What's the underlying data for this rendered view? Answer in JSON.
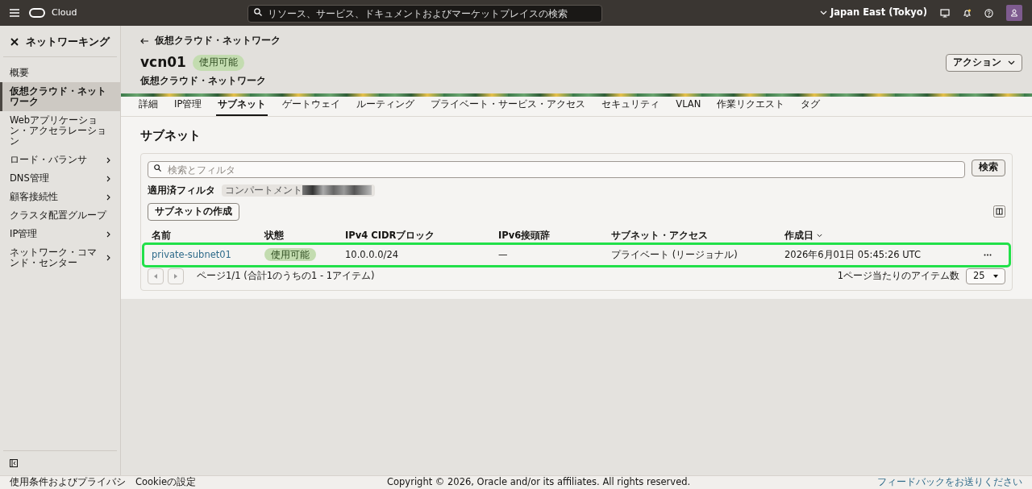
{
  "topbar": {
    "brand": "Cloud",
    "search_placeholder": "リソース、サービス、ドキュメントおよびマーケットプレイスの検索",
    "region": "Japan East (Tokyo)"
  },
  "sidebar": {
    "title": "ネットワーキング",
    "items": [
      {
        "label": "概要",
        "selected": false,
        "expandable": false
      },
      {
        "label": "仮想クラウド・ネットワーク",
        "selected": true,
        "expandable": false
      },
      {
        "label": "Webアプリケーション・アクセラレーション",
        "selected": false,
        "expandable": false
      },
      {
        "label": "ロード・バランサ",
        "selected": false,
        "expandable": true
      },
      {
        "label": "DNS管理",
        "selected": false,
        "expandable": true
      },
      {
        "label": "顧客接続性",
        "selected": false,
        "expandable": true
      },
      {
        "label": "クラスタ配置グループ",
        "selected": false,
        "expandable": false
      },
      {
        "label": "IP管理",
        "selected": false,
        "expandable": true
      },
      {
        "label": "ネットワーク・コマンド・センター",
        "selected": false,
        "expandable": true
      }
    ]
  },
  "header": {
    "breadcrumb": "仮想クラウド・ネットワーク",
    "name": "vcn01",
    "status": "使用可能",
    "type": "仮想クラウド・ネットワーク",
    "actions_button": "アクション"
  },
  "tabs": [
    {
      "label": "詳細",
      "selected": false
    },
    {
      "label": "IP管理",
      "selected": false
    },
    {
      "label": "サブネット",
      "selected": true
    },
    {
      "label": "ゲートウェイ",
      "selected": false
    },
    {
      "label": "ルーティング",
      "selected": false
    },
    {
      "label": "プライベート・サービス・アクセス",
      "selected": false
    },
    {
      "label": "セキュリティ",
      "selected": false
    },
    {
      "label": "VLAN",
      "selected": false
    },
    {
      "label": "作業リクエスト",
      "selected": false
    },
    {
      "label": "タグ",
      "selected": false
    }
  ],
  "section": {
    "title": "サブネット",
    "search_placeholder": "検索とフィルタ",
    "search_button": "検索",
    "applied_filter_label": "適用済フィルタ",
    "filter_chip": "コンパートメント",
    "create_button": "サブネットの作成"
  },
  "table": {
    "columns": [
      {
        "label": "名前",
        "sorted": false
      },
      {
        "label": "状態",
        "sorted": false
      },
      {
        "label": "IPv4 CIDRブロック",
        "sorted": false
      },
      {
        "label": "IPv6接頭辞",
        "sorted": false
      },
      {
        "label": "サブネット・アクセス",
        "sorted": false
      },
      {
        "label": "作成日",
        "sorted": true
      }
    ],
    "rows": [
      {
        "name": "private-subnet01",
        "status": "使用可能",
        "ipv4": "10.0.0.0/24",
        "ipv6": "—",
        "access": "プライベート (リージョナル)",
        "created": "2026年6月01日 05:45:26 UTC",
        "highlighted": true
      }
    ]
  },
  "pagination": {
    "summary": "ページ1/1 (合計1のうちの1 - 1アイテム)",
    "per_page_label": "1ページ当たりのアイテム数",
    "per_page": "25"
  },
  "footer": {
    "links": [
      "使用条件およびプライバシ",
      "Cookieの設定"
    ],
    "copyright": "Copyright © 2026, Oracle and/or its affiliates. All rights reserved.",
    "feedback": "フィードバックをお送りください"
  }
}
